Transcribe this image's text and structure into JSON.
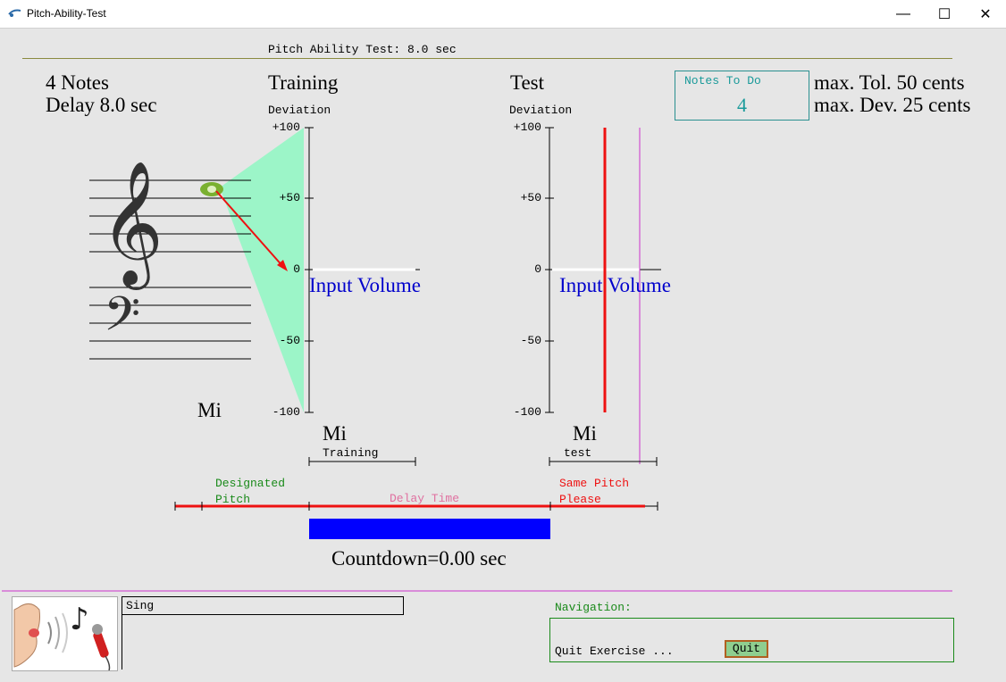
{
  "window": {
    "title": "Pitch-Ability-Test",
    "minimize_label": "—",
    "maximize_label": "☐",
    "close_label": "✕"
  },
  "header": {
    "test_time": "Pitch Ability Test: 8.0 sec"
  },
  "info": {
    "notes_count": "4 Notes",
    "delay": "Delay 8.0 sec",
    "max_tol": "max. Tol. 50 cents",
    "max_dev": "max. Dev. 25 cents"
  },
  "notes_to_do": {
    "label": "Notes To Do",
    "value": "4"
  },
  "staff": {
    "note_name": "Mi"
  },
  "training": {
    "title": "Training",
    "axis_label": "Deviation",
    "ticks": [
      "+100",
      "+50",
      "0",
      "-50",
      "-100"
    ],
    "input_volume": "Input Volume",
    "note_name": "Mi",
    "sub_label": "Training"
  },
  "test": {
    "title": "Test",
    "axis_label": "Deviation",
    "ticks": [
      "+100",
      "+50",
      "0",
      "-50",
      "-100"
    ],
    "input_volume": "Input Volume",
    "note_name": "Mi",
    "sub_label": "test"
  },
  "timeline": {
    "designated_pitch": [
      "Designated",
      "Pitch"
    ],
    "delay_time": "Delay Time",
    "same_pitch": [
      "Same Pitch",
      "Please"
    ]
  },
  "countdown": "Countdown=0.00 sec",
  "status": {
    "sing_text": "Sing"
  },
  "navigation": {
    "label": "Navigation:",
    "quit_exercise": "Quit Exercise ...",
    "quit_button": "Quit"
  },
  "icons": [
    "app-icon",
    "singer-icon",
    "treble-clef-icon",
    "bass-clef-icon",
    "note-icon"
  ],
  "colors": {
    "accent_red": "#ee1111",
    "teal": "#1a9a9a",
    "green": "#1a8a1a",
    "blue_bar": "#0000ff",
    "volume_text": "#0000cc",
    "pink": "#e070a0",
    "cone": "#9cf5c8",
    "magenta": "#cc33cc"
  }
}
